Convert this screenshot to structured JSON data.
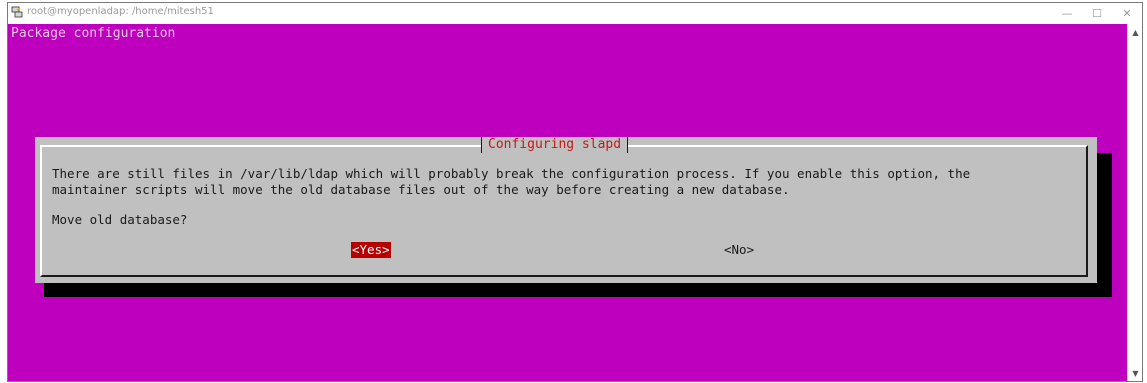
{
  "window": {
    "title": "root@myopenladap: /home/mitesh51",
    "minimize_glyph": "—",
    "maximize_glyph": "☐",
    "close_glyph": "✕"
  },
  "terminal": {
    "header": "Package configuration",
    "background_color": "#be00be"
  },
  "dialog": {
    "title": "Configuring slapd",
    "message_line1": "There are still files in /var/lib/ldap which will probably break the configuration process. If you enable this option, the",
    "message_line2": "maintainer scripts will move the old database files out of the way before creating a new database.",
    "question": "Move old database?",
    "yes_label": "<Yes>",
    "no_label": "<No>",
    "selected": "Yes"
  },
  "scrollbar": {
    "up_icon": "scroll-up-icon",
    "down_icon": "scroll-down-icon"
  }
}
